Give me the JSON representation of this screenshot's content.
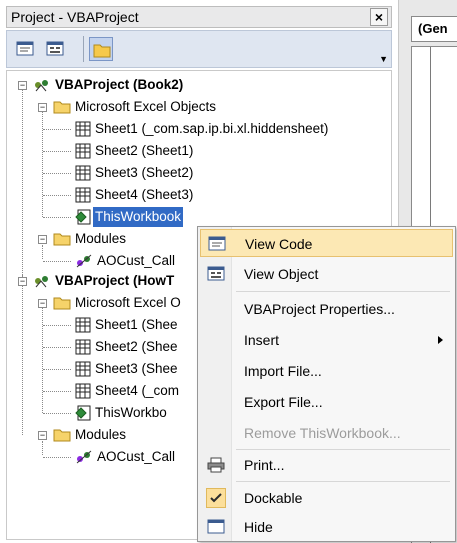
{
  "panel": {
    "title": "Project - VBAProject",
    "close_symbol": "×"
  },
  "toolbar": {
    "view_code_icon": "view-code-icon",
    "view_object_icon": "view-object-icon",
    "toggle_folders_icon": "toggle-folders-icon"
  },
  "tree": {
    "book2": "VBAProject (Book2)",
    "book2_excel_objects": "Microsoft Excel Objects",
    "book2_sheet1": "Sheet1 (_com.sap.ip.bi.xl.hiddensheet)",
    "book2_sheet2": "Sheet2 (Sheet1)",
    "book2_sheet3": "Sheet3 (Sheet2)",
    "book2_sheet4": "Sheet4 (Sheet3)",
    "book2_thisworkbook": "ThisWorkbook",
    "book2_modules": "Modules",
    "book2_module1": "AOCust_Call",
    "how": "VBAProject (HowT",
    "how_excel_objects": "Microsoft Excel O",
    "how_sheet1": "Sheet1 (Shee",
    "how_sheet2": "Sheet2 (Shee",
    "how_sheet3": "Sheet3 (Shee",
    "how_sheet4": "Sheet4 (_com",
    "how_thisworkbook": "ThisWorkbo",
    "how_modules": "Modules",
    "how_module1": "AOCust_Call"
  },
  "code_pane": {
    "object_combo": "(Gen"
  },
  "context_menu": {
    "view_code": "View Code",
    "view_object": "View Object",
    "properties": "VBAProject Properties...",
    "insert": "Insert",
    "import_file": "Import File...",
    "export_file": "Export File...",
    "remove": "Remove ThisWorkbook...",
    "print": "Print...",
    "dockable": "Dockable",
    "hide": "Hide"
  },
  "colors": {
    "selection": "#316ac5",
    "menu_hover": "#fce8b4",
    "toolbar_bg": "#dfe6f1"
  }
}
